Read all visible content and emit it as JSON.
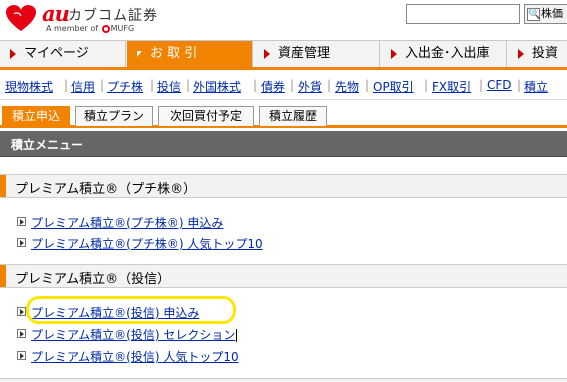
{
  "brand": {
    "au": "au",
    "name": "カブコム証券",
    "member_prefix": "A member of",
    "member_group": "MUFG"
  },
  "search": {
    "placeholder": "",
    "button_label": "株価"
  },
  "main_nav": [
    {
      "label": "マイページ",
      "active": false
    },
    {
      "label": "お 取 引",
      "active": true
    },
    {
      "label": "資産管理",
      "active": false
    },
    {
      "label": "入出金･入出庫",
      "active": false
    },
    {
      "label": "投資",
      "active": false
    }
  ],
  "sub_nav": [
    "現物株式",
    "信用",
    "プチ株",
    "投信",
    "外国株式",
    "債券",
    "外貨",
    "先物",
    "OP取引",
    "FX取引",
    "CFD",
    "積立"
  ],
  "tabs": [
    "積立申込",
    "積立プラン",
    "次回買付予定",
    "積立履歴"
  ],
  "menu_header": "積立メニュー",
  "sections": [
    {
      "title": "プレミアム積立®（プチ株®）",
      "links": [
        "プレミアム積立®(プチ株®) 申込み",
        "プレミアム積立®(プチ株®) 人気トップ10"
      ]
    },
    {
      "title": "プレミアム積立®（投信）",
      "links": [
        "プレミアム積立®(投信) 申込み",
        "プレミアム積立®(投信) セレクション",
        "プレミアム積立®(投信) 人気トップ10"
      ]
    }
  ],
  "colors": {
    "accent": "#f08300",
    "brand_red": "#e60012",
    "link": "#002aa8",
    "menu_header_bg": "#666666",
    "highlight": "#ffe600"
  }
}
